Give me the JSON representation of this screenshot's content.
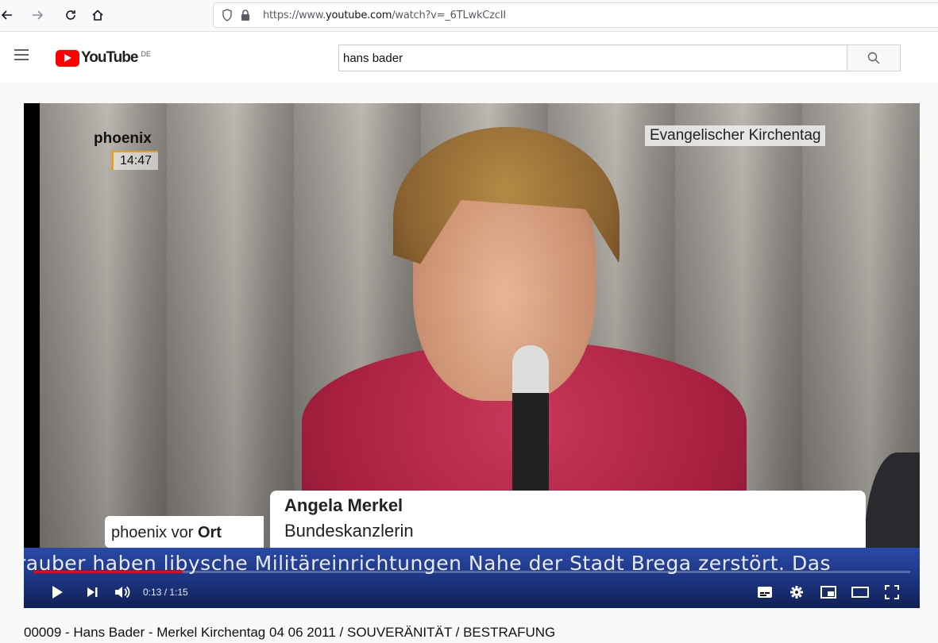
{
  "browser": {
    "url_prefix": "https://www.",
    "url_domain": "youtube.com",
    "url_path": "/watch?v=_6TLwkCzcII"
  },
  "header": {
    "logo_text": "YouTube",
    "region": "DE",
    "search_value": "hans bader"
  },
  "video": {
    "channel_logo": "phoenix",
    "clock": "14:47",
    "event_label": "Evangelischer Kirchentag",
    "lower_third_name": "Angela Merkel",
    "lower_third_role": "Bundeskanzlerin",
    "program_name_prefix": "phoenix vor ",
    "program_name_bold": "Ort",
    "ticker_text": "rauber haben libysche Militäreinrichtungen Nahe der Stadt Brega zerstört. Das",
    "current_time": "0:13",
    "duration": "1:15",
    "time_display": "0:13 / 1:15",
    "progress_fraction": 0.17
  },
  "title": "00009 - Hans Bader - Merkel Kirchentag 04 06 2011 / SOUVERÄNITÄT / BESTRAFUNG",
  "colors": {
    "youtube_red": "#ff0000",
    "ticker_blue": "#1b327a",
    "progress_red": "#ff0000"
  }
}
